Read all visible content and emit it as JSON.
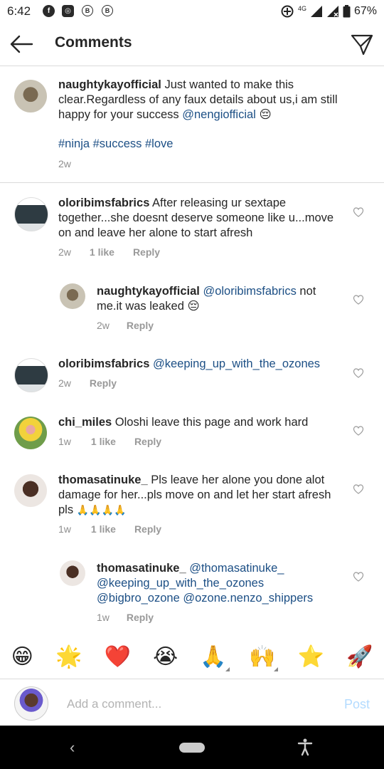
{
  "status_bar": {
    "time": "6:42",
    "battery": "67%",
    "network": "4G"
  },
  "header": {
    "title": "Comments"
  },
  "caption": {
    "username": "naughtykayofficial",
    "text": " Just wanted to make this clear.Regardless of any faux details about us,i am still happy for your success ",
    "mention": "@nengiofficial",
    "emoji": "😔",
    "hashtags": "#ninja #success #love",
    "time": "2w"
  },
  "comments": [
    {
      "username": "oloribimsfabrics",
      "text": " After releasing ur sextape together...she doesnt deserve someone like u...move on and leave her alone to start afresh",
      "time": "2w",
      "likes": "1 like",
      "reply": "Reply"
    },
    {
      "username": "naughtykayofficial",
      "mention": "@oloribimsfabrics",
      "text": " not me.it was leaked ",
      "emoji": "😔",
      "time": "2w",
      "reply": "Reply"
    },
    {
      "username": "oloribimsfabrics",
      "mention": "@keeping_up_with_the_ozones",
      "time": "2w",
      "reply": "Reply"
    },
    {
      "username": "chi_miles",
      "text": " Oloshi leave this page and work hard",
      "time": "1w",
      "likes": "1 like",
      "reply": "Reply"
    },
    {
      "username": "thomasatinuke_",
      "text": " Pls leave her alone you done alot  damage for her...pls  move on and let her start afresh pls ",
      "emoji": "🙏🙏🙏🙏",
      "time": "1w",
      "likes": "1 like",
      "reply": "Reply"
    },
    {
      "username": "thomasatinuke_",
      "mention1": "@thomasatinuke_",
      "mention2": "@keeping_up_with_the_ozones",
      "mention3": "@bigbro_ozone",
      "mention4": "@ozone.nenzo_shippers",
      "time": "1w",
      "reply": "Reply"
    }
  ],
  "emoji_bar": [
    "😁",
    "🌟",
    "❤️",
    "😭",
    "🙏",
    "🙌",
    "⭐",
    "🚀"
  ],
  "add_comment": {
    "placeholder": "Add a comment...",
    "post_label": "Post"
  },
  "colors": {
    "mention": "#1c4f85",
    "meta": "#8e8e8e",
    "post_disabled": "#b3dbff"
  }
}
